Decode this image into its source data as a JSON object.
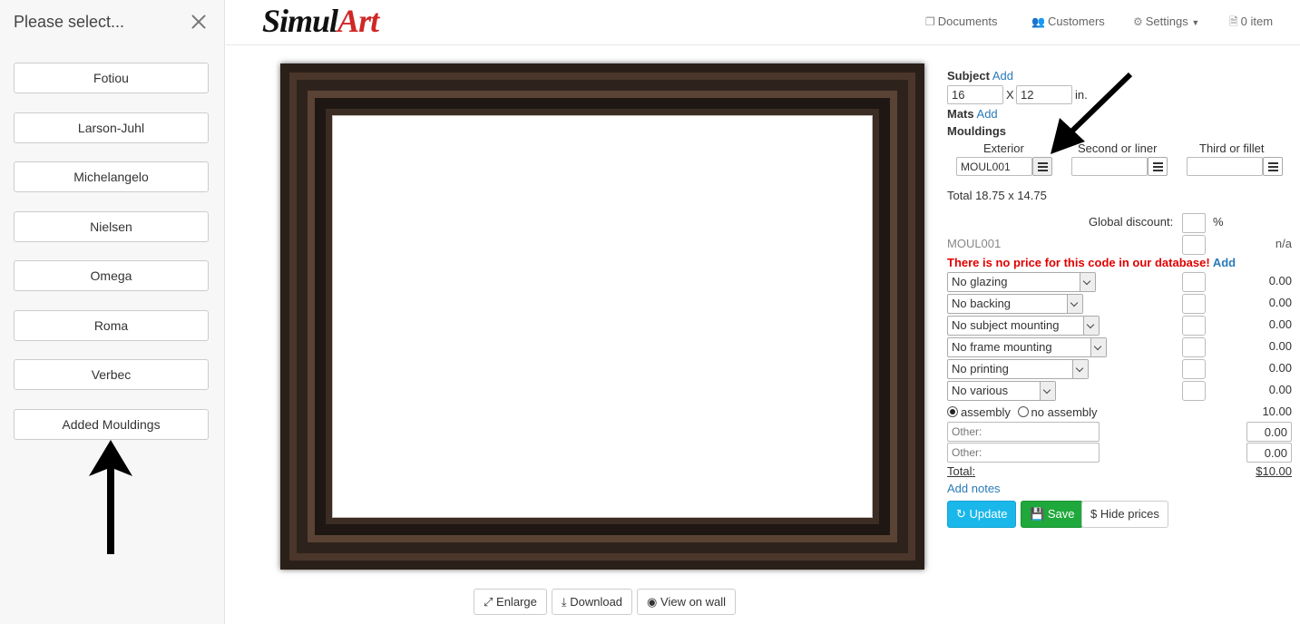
{
  "sidebar": {
    "title": "Please select...",
    "close_icon": "close-icon",
    "brands": [
      {
        "label": "Fotiou"
      },
      {
        "label": "Larson-Juhl"
      },
      {
        "label": "Michelangelo"
      },
      {
        "label": "Nielsen"
      },
      {
        "label": "Omega"
      },
      {
        "label": "Roma"
      },
      {
        "label": "Verbec"
      },
      {
        "label": "Added Mouldings"
      }
    ]
  },
  "header": {
    "logo_main": "Simul",
    "logo_accent": "Art",
    "nav": [
      {
        "label": "Documents",
        "icon": "documents-icon"
      },
      {
        "label": "Customers",
        "icon": "users-icon"
      },
      {
        "label": "Settings",
        "icon": "gear-icon"
      },
      {
        "label": "0 item",
        "icon": "file-icon"
      }
    ]
  },
  "preview": {
    "buttons": [
      {
        "label": "Enlarge",
        "icon": "expand-icon"
      },
      {
        "label": "Download",
        "icon": "download-icon"
      },
      {
        "label": "View on wall",
        "icon": "eye-icon"
      }
    ]
  },
  "panel": {
    "subject_label": "Subject",
    "subject_add": "Add",
    "width": "16",
    "x_sep": "X",
    "height": "12",
    "unit": "in.",
    "mats_label": "Mats",
    "mats_add": "Add",
    "mouldings_label": "Mouldings",
    "moulding_cols": [
      {
        "label": "Exterior",
        "value": "MOUL001"
      },
      {
        "label": "Second or liner",
        "value": ""
      },
      {
        "label": "Third or fillet",
        "value": ""
      }
    ],
    "total_size": "Total 18.75 x 14.75",
    "global_discount_label": "Global discount:",
    "global_discount_value": "",
    "percent": "%",
    "moulding_code": "MOUL001",
    "moulding_price": "n/a",
    "no_price_warning": "There is no price for this code in our database!",
    "no_price_add": "Add",
    "options": [
      {
        "label": "No glazing",
        "price": "0.00"
      },
      {
        "label": "No backing",
        "price": "0.00"
      },
      {
        "label": "No subject mounting",
        "price": "0.00"
      },
      {
        "label": "No frame mounting",
        "price": "0.00"
      },
      {
        "label": "No printing",
        "price": "0.00"
      },
      {
        "label": "No various",
        "price": "0.00"
      }
    ],
    "assembly_label": "assembly",
    "no_assembly_label": "no assembly",
    "assembly_selected": "assembly",
    "assembly_price": "10.00",
    "other_placeholder": "Other:",
    "other_prices": [
      "0.00",
      "0.00"
    ],
    "total_label": "Total:",
    "total_value": "$10.00",
    "add_notes": "Add notes",
    "update_label": "Update",
    "save_label": "Save",
    "hide_prices_label": "Hide prices",
    "colors": {
      "update": "#1ab7ea",
      "save": "#1fa83c",
      "warning": "#e00000",
      "link": "#2a7ab8"
    }
  }
}
